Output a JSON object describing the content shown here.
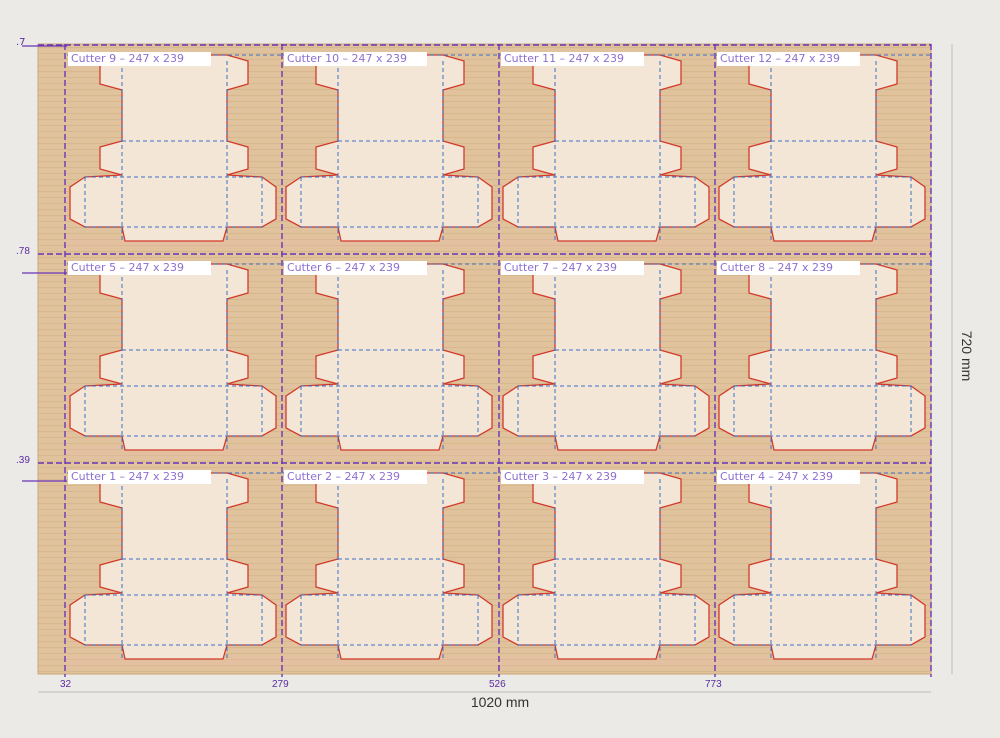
{
  "sheet": {
    "width_label": "1020 mm",
    "height_label": "720 mm",
    "top_marker": ".7"
  },
  "row_markers": [
    ".78",
    ".39"
  ],
  "column_markers": [
    "32",
    "279",
    "526",
    "773"
  ],
  "cutters": [
    {
      "label": "Cutter 9 – 247 x 239"
    },
    {
      "label": "Cutter 10 – 247 x 239"
    },
    {
      "label": "Cutter 11 – 247 x 239"
    },
    {
      "label": "Cutter 12 – 247 x 239"
    },
    {
      "label": "Cutter 5 – 247 x 239"
    },
    {
      "label": "Cutter 6 – 247 x 239"
    },
    {
      "label": "Cutter 7 – 247 x 239"
    },
    {
      "label": "Cutter 8 – 247 x 239"
    },
    {
      "label": "Cutter 1 – 247 x 239"
    },
    {
      "label": "Cutter 2 – 247 x 239"
    },
    {
      "label": "Cutter 3 – 247 x 239"
    },
    {
      "label": "Cutter 4 – 247 x 239"
    }
  ],
  "colors": {
    "board": "#e0c39c",
    "blank": "#f3e6d6",
    "cut_line": "#d23a2a",
    "fold_line": "#3b6fc9",
    "guide": "#6a35b8"
  }
}
